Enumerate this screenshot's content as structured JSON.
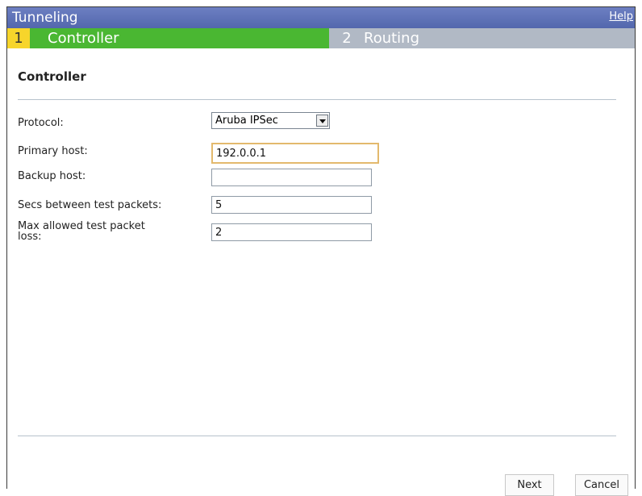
{
  "window": {
    "title": "Tunneling",
    "help_label": "Help"
  },
  "steps": [
    {
      "number": "1",
      "label": "Controller",
      "active": true
    },
    {
      "number": "2",
      "label": "Routing",
      "active": false
    }
  ],
  "section": {
    "title": "Controller"
  },
  "form": {
    "protocol": {
      "label": "Protocol:",
      "value": "Aruba IPSec"
    },
    "primary_host": {
      "label": "Primary host:",
      "value": "192.0.0.1"
    },
    "backup_host": {
      "label": "Backup host:",
      "value": ""
    },
    "secs_between": {
      "label": "Secs between test packets:",
      "value": "5"
    },
    "max_loss": {
      "label_line1": "Max allowed test packet",
      "label_line2": "loss:",
      "value": "2"
    }
  },
  "buttons": {
    "next": "Next",
    "cancel": "Cancel"
  },
  "colors": {
    "titlebar": "#5b6fb5",
    "active_step": "#4ab732",
    "step_number": "#f7d52b",
    "inactive_step": "#b1b9c5"
  }
}
